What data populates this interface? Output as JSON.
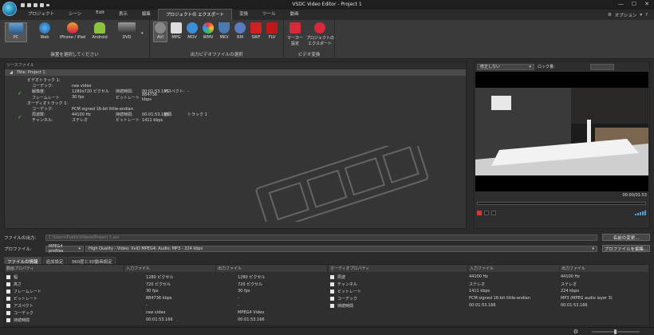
{
  "window": {
    "title": "VSDC Video Editor - Project 1",
    "options_label": "オプション"
  },
  "menu": {
    "items": [
      "プロジェクト",
      "シーン",
      "Edit",
      "表示",
      "編集",
      "プロジェクトの エクスポート",
      "変換",
      "ツール",
      "動画"
    ],
    "active_index": 5
  },
  "ribbon": {
    "devices": {
      "caption": "装置を選択してください",
      "buttons": [
        "PC",
        "Web",
        "iPhone / iPad",
        "Android",
        "DVD"
      ]
    },
    "formats": {
      "caption": "出力ビデオファイルの選択",
      "buttons": [
        "AVI",
        "MPG",
        "MOV",
        "WMV",
        "MKV",
        "RM",
        "SWF",
        "FLV"
      ],
      "selected": "AVI"
    },
    "convert": {
      "caption": "ビデオ変換",
      "buttons": [
        "マーカー\n設定",
        "プロジェクトの\nエクスポート"
      ],
      "marker_label_1": "マーカー",
      "marker_label_2": "設定",
      "export_label_1": "プロジェクトの",
      "export_label_2": "エクスポート"
    }
  },
  "source": {
    "header": "ソースファイル",
    "project_label": "Title: Project 1",
    "video_track": "ビデオトラック 1:",
    "codec_label": "コーデック:",
    "codec_value": "raw video",
    "res_label": "解像度:",
    "res_value": "1280x720 ピクセル",
    "dur_label": "持続時間:",
    "dur_value": "00:01:53.166",
    "aspect_label": "アスペクト:",
    "aspect_value": "-",
    "fps_label": "フレームレート",
    "fps_value": "30 fps",
    "bitrate_label": "ビットレート",
    "bitrate_value": "884736 kbps",
    "audio_track": "オーディオトラック 1:",
    "acodec_value": "PCM signed 16-bit little-endian",
    "freq_label": "周波数:",
    "freq_value": "44100 Hz",
    "adur_value": "00:01:53.166",
    "audio_label": "音源:",
    "audio_value": "トラック 1",
    "channels_label": "チャンネル:",
    "channels_value": "ステレオ",
    "abitrate_value": "1411 kbps"
  },
  "preview": {
    "dropdown": "修正しない",
    "label": "ロック量:",
    "time": "00:00/01:53"
  },
  "output": {
    "file_label": "ファイルの出力:",
    "file_path": "C:\\Users\\Public\\Videos\\Project 1.avi",
    "rename_btn": "名前の変更...",
    "profile_label": "プロファイル:",
    "profile_value": "MPEG4 profiles",
    "quality_value": "High Quality - Video: XviD MPEG4; Audio: MP3 - 224 kbps",
    "edit_profile_btn": "プロファイルを編集..."
  },
  "tabs": [
    "ファイルの情報",
    "追加設定",
    "360度と3D動画設定"
  ],
  "video_props": {
    "headers": [
      "動画プロパティ",
      "入力ファイル",
      "出力ファイル"
    ],
    "rows": [
      [
        "幅",
        "1280 ピクセル",
        "1280 ピクセル"
      ],
      [
        "高さ",
        "720 ピクセル",
        "720 ピクセル"
      ],
      [
        "フレームレート",
        "30 fps",
        "30 fps"
      ],
      [
        "ビットレート",
        "884736 kbps",
        "-"
      ],
      [
        "アスペクト",
        "-",
        "-"
      ],
      [
        "コーデック",
        "raw video",
        "MPEG4 Video"
      ],
      [
        "持続時間",
        "00:01:53.166",
        "00:01:53.166"
      ]
    ]
  },
  "audio_props": {
    "headers": [
      "オーディオプロパティ",
      "入力ファイル",
      "出力ファイル"
    ],
    "rows": [
      [
        "周波",
        "44100 Hz",
        "44100 Hz"
      ],
      [
        "チャンネル",
        "ステレオ",
        "ステレオ"
      ],
      [
        "ビットレート",
        "1411 kbps",
        "224 kbps"
      ],
      [
        "コーデック",
        "PCM signed 16-bit little-endian",
        "MP3 (MPEG audio layer 3)"
      ],
      [
        "持続時間",
        "00:01:53.166",
        "00:01:53.166"
      ]
    ]
  },
  "colors": {
    "accent": "#4aa3df",
    "check": "#5fcf3a",
    "record": "#e03030"
  }
}
